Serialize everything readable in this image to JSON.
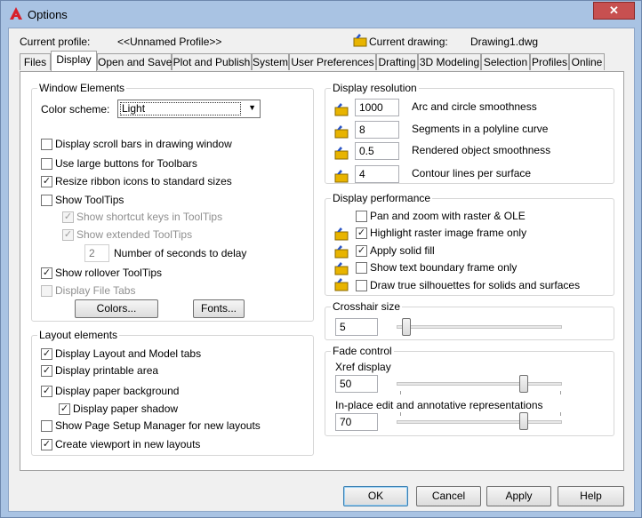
{
  "window": {
    "title": "Options",
    "close_glyph": "✕"
  },
  "profile": {
    "current_profile_label": "Current profile:",
    "current_profile_value": "<<Unnamed Profile>>",
    "current_drawing_label": "Current drawing:",
    "current_drawing_value": "Drawing1.dwg"
  },
  "tabs": [
    "Files",
    "Display",
    "Open and Save",
    "Plot and Publish",
    "System",
    "User Preferences",
    "Drafting",
    "3D Modeling",
    "Selection",
    "Profiles",
    "Online"
  ],
  "active_tab": "Display",
  "window_elements": {
    "title": "Window Elements",
    "color_scheme_label": "Color scheme:",
    "color_scheme_value": "Light",
    "checkboxes": [
      {
        "label": "Display scroll bars in drawing window",
        "checked": false,
        "enabled": true
      },
      {
        "label": "Use large buttons for Toolbars",
        "checked": false,
        "enabled": true
      },
      {
        "label": "Resize ribbon icons to standard sizes",
        "checked": true,
        "enabled": true
      },
      {
        "label": "Show ToolTips",
        "checked": false,
        "enabled": true
      },
      {
        "label": "Show shortcut keys in ToolTips",
        "checked": true,
        "enabled": false
      },
      {
        "label": "Show extended ToolTips",
        "checked": true,
        "enabled": false
      },
      {
        "label": "Show rollover ToolTips",
        "checked": true,
        "enabled": true
      },
      {
        "label": "Display File Tabs",
        "checked": false,
        "enabled": false
      }
    ],
    "delay_value": "2",
    "delay_label": "Number of seconds to delay",
    "colors_button": "Colors...",
    "fonts_button": "Fonts..."
  },
  "layout_elements": {
    "title": "Layout elements",
    "checkboxes": [
      {
        "label": "Display Layout and Model tabs",
        "checked": true
      },
      {
        "label": "Display printable area",
        "checked": true
      },
      {
        "label": "Display paper background",
        "checked": true
      },
      {
        "label": "Display paper shadow",
        "checked": true
      },
      {
        "label": "Show Page Setup Manager for new layouts",
        "checked": false
      },
      {
        "label": "Create viewport in new layouts",
        "checked": true
      }
    ]
  },
  "display_resolution": {
    "title": "Display resolution",
    "items": [
      {
        "value": "1000",
        "label": "Arc and circle smoothness"
      },
      {
        "value": "8",
        "label": "Segments in a polyline curve"
      },
      {
        "value": "0.5",
        "label": "Rendered object smoothness"
      },
      {
        "value": "4",
        "label": "Contour lines per surface"
      }
    ]
  },
  "display_performance": {
    "title": "Display performance",
    "items": [
      {
        "label": "Pan and zoom with raster & OLE",
        "checked": false,
        "icon": false
      },
      {
        "label": "Highlight raster image frame only",
        "checked": true,
        "icon": true
      },
      {
        "label": "Apply solid fill",
        "checked": true,
        "icon": true
      },
      {
        "label": "Show text boundary frame only",
        "checked": false,
        "icon": true
      },
      {
        "label": "Draw true silhouettes for solids and surfaces",
        "checked": false,
        "icon": true
      }
    ]
  },
  "crosshair": {
    "title": "Crosshair size",
    "value": "5",
    "level_fraction": 0.05
  },
  "fade_control": {
    "title": "Fade control",
    "xref_label": "Xref display",
    "xref_value": "50",
    "inplace_label": "In-place edit and annotative representations",
    "inplace_value": "70"
  },
  "buttons": {
    "ok": "OK",
    "cancel": "Cancel",
    "apply": "Apply",
    "help": "Help"
  },
  "colors": {
    "accent": "#3c7fb1",
    "close": "#c75050",
    "frame": "#a9c3e3"
  }
}
